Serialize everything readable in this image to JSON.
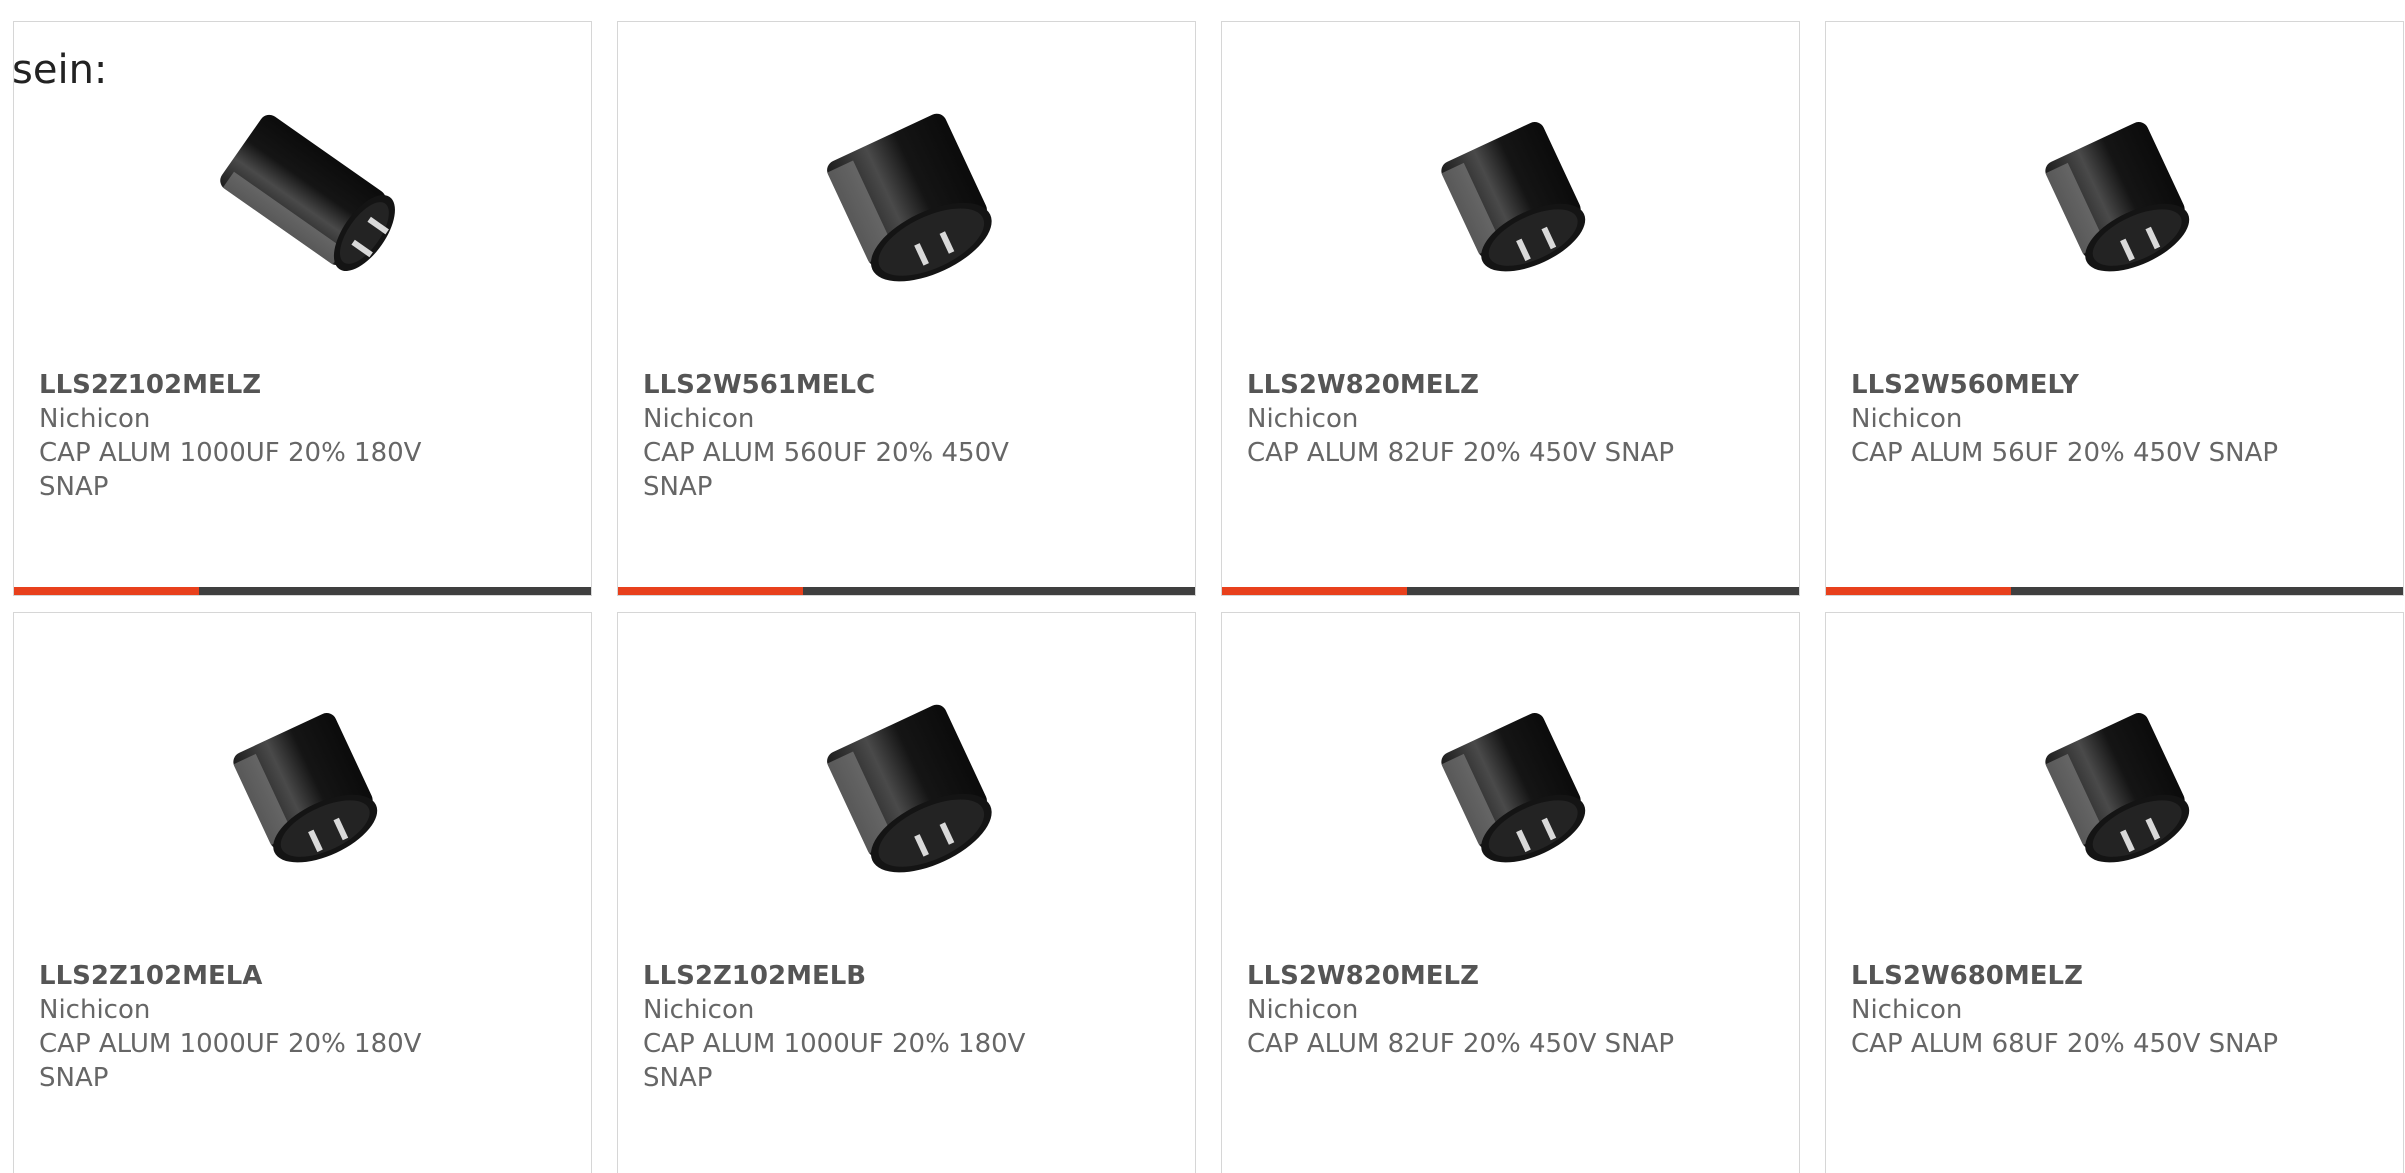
{
  "lead_text": "sein:",
  "colors": {
    "accent": "#e8401c",
    "bar": "#3f3f3f",
    "border": "#d6d6d6",
    "text_muted": "#666666",
    "text_strong": "#555555"
  },
  "products": [
    {
      "part_number": "LLS2Z102MELZ",
      "manufacturer": "Nichicon",
      "description": "CAP ALUM 1000UF 20% 180V SNAP",
      "image_icon": "capacitor-tall",
      "bar_progress": 0.32
    },
    {
      "part_number": "LLS2W561MELC",
      "manufacturer": "Nichicon",
      "description": "CAP ALUM 560UF 20% 450V SNAP",
      "image_icon": "capacitor-wide",
      "bar_progress": 0.32
    },
    {
      "part_number": "LLS2W820MELZ",
      "manufacturer": "Nichicon",
      "description": "CAP ALUM 82UF 20% 450V SNAP",
      "image_icon": "capacitor-short",
      "bar_progress": 0.32
    },
    {
      "part_number": "LLS2W560MELY",
      "manufacturer": "Nichicon",
      "description": "CAP ALUM 56UF 20% 450V SNAP",
      "image_icon": "capacitor-short",
      "bar_progress": 0.32
    },
    {
      "part_number": "LLS2Z102MELA",
      "manufacturer": "Nichicon",
      "description": "CAP ALUM 1000UF 20% 180V SNAP",
      "image_icon": "capacitor-short",
      "bar_progress": 0.32
    },
    {
      "part_number": "LLS2Z102MELB",
      "manufacturer": "Nichicon",
      "description": "CAP ALUM 1000UF 20% 180V SNAP",
      "image_icon": "capacitor-wide",
      "bar_progress": 0.32
    },
    {
      "part_number": "LLS2W820MELZ",
      "manufacturer": "Nichicon",
      "description": "CAP ALUM 82UF 20% 450V SNAP",
      "image_icon": "capacitor-short",
      "bar_progress": 0.32
    },
    {
      "part_number": "LLS2W680MELZ",
      "manufacturer": "Nichicon",
      "description": "CAP ALUM 68UF 20% 450V SNAP",
      "image_icon": "capacitor-short",
      "bar_progress": 0.32
    }
  ]
}
